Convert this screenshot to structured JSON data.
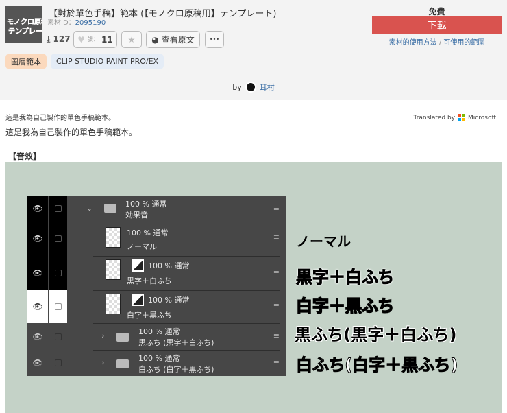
{
  "header": {
    "thumb_text": [
      "モノクロ原稿",
      "テンプレート"
    ],
    "title": "【對於單色手稿】範本 (【モノクロ原稿用】テンプレート)",
    "material_id_label": "素材ID：",
    "material_id": "2095190",
    "downloads": "127",
    "likes_label": "讚：",
    "likes": "11",
    "view_original": "查看原文",
    "more": "•••",
    "tags": [
      "圖層範本",
      "CLIP STUDIO PAINT PRO/EX"
    ]
  },
  "purchase": {
    "price": "免費",
    "download": "下載",
    "usage_link": "素材的使用方法",
    "sep": "/",
    "scope_link": "可使用的範圍"
  },
  "author": {
    "by": "by",
    "name": "耳村"
  },
  "content": {
    "line_original": "這是我為自己製作的單色手稿範本。",
    "line_translated": "這是我為自己製作的單色手稿範本。",
    "translated_by": "Translated by",
    "microsoft": "Microsoft",
    "section": "【音效】"
  },
  "layers": [
    {
      "top": "100 % 通常",
      "name": "効果音"
    },
    {
      "top": "100 % 通常",
      "name": "ノーマル"
    },
    {
      "top": "100 % 通常",
      "name": "黒字＋白ふち"
    },
    {
      "top": "100 % 通常",
      "name": "白字＋黒ふち"
    },
    {
      "top": "100 % 通常",
      "name": "黒ふち (黒字＋白ふち)"
    },
    {
      "top": "100 % 通常",
      "name": "白ふち (白字＋黒ふち)"
    }
  ],
  "samples": [
    "ノーマル",
    "黒字＋白ふち",
    "白字＋黒ふち",
    "黒ふち(黒字＋白ふち)",
    "白ふち(白字＋黒ふち)"
  ]
}
